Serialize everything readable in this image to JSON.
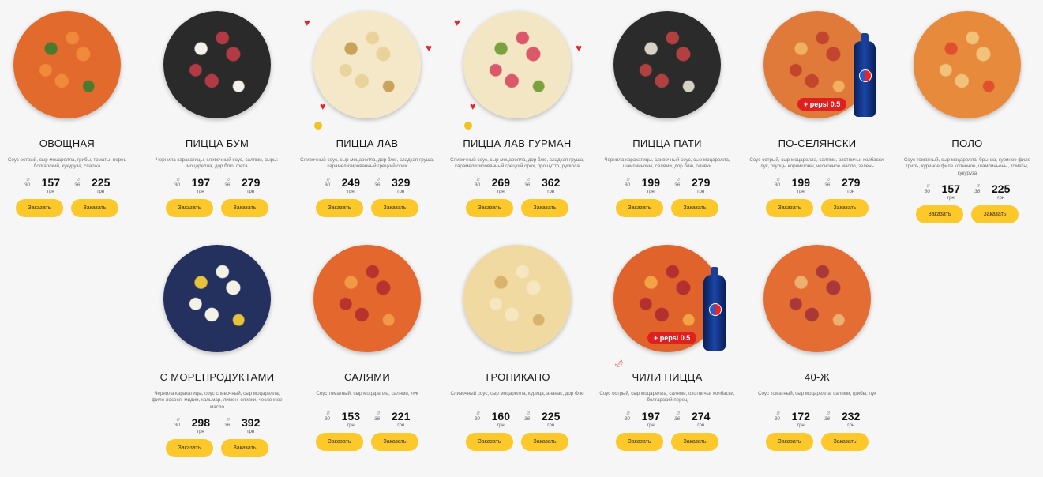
{
  "colors": {
    "button_bg": "#fdc829",
    "background": "#f6f6f6",
    "pepsi_badge": "#e02020"
  },
  "sizes": {
    "small": "30",
    "large": "36"
  },
  "currency": "грн",
  "order_label": "Заказать",
  "pepsi_badge": "+ pepsi 0.5",
  "pizzas": [
    {
      "name": "ОВОЩНАЯ",
      "desc": "Соус острый, сыр моцарелла, грибы, томаты, перец болгарский, кукуруза, спаржа",
      "price_small": "157",
      "price_large": "225",
      "palette": [
        "#e26a2c",
        "#f08a3a",
        "#4a7a2e"
      ]
    },
    {
      "name": "ПИЦЦА БУМ",
      "desc": "Чернила каракатицы, сливочный соус, салями, сыры: моцарелла, дор блю, фета",
      "price_small": "197",
      "price_large": "279",
      "palette": [
        "#2a2a2a",
        "#b23a45",
        "#f4f0ea"
      ]
    },
    {
      "name": "ПИЦЦА ЛАВ",
      "desc": "Сливочный соус, сыр моцарелла, дор блю, сладкая груша, карамелизированный грецкий орех",
      "price_small": "249",
      "price_large": "329",
      "palette": [
        "#f4e8c8",
        "#e9d39a",
        "#c9a25c"
      ]
    },
    {
      "name": "ПИЦЦА ЛАВ ГУРМАН",
      "desc": "Сливочный соус, сыр моцарелла, дор блю, сладкая груша, карамелизированный грецкий орех, прошутто, руккола",
      "price_small": "269",
      "price_large": "362",
      "palette": [
        "#f3e6c4",
        "#d9586a",
        "#7aa13e"
      ]
    },
    {
      "name": "ПИЦЦА ПАТИ",
      "desc": "Чернила каракатицы, сливочный соус, сыр моцарелла, шампиньоны, салями, дор блю, оливки",
      "price_small": "199",
      "price_large": "279",
      "palette": [
        "#2b2b2b",
        "#b34040",
        "#d8d1c6"
      ]
    },
    {
      "name": "ПО-СЕЛЯНСКИ",
      "desc": "Соус острый, сыр моцарелла, салями, охотничьи колбаски, лук, огурцы корнишоны, чесночное масло, зелень",
      "price_small": "199",
      "price_large": "279",
      "palette": [
        "#e07a3a",
        "#c4452e",
        "#f0b060"
      ]
    },
    {
      "name": "ПОЛО",
      "desc": "Соус томатный, сыр моцарелла, брынза, куриное филе гриль, куриное филе копченое, шампиньоны, томаты, кукуруза",
      "price_small": "157",
      "price_large": "225",
      "palette": [
        "#e88a3c",
        "#f3c27a",
        "#e0502e"
      ]
    },
    {
      "name": "С МОРЕПРОДУКТАМИ",
      "desc": "Чернила каракатицы, соус сливочный, сыр моцарелла, филе лосося, мидии, кальмар, лимон, оливки, чесночное масло",
      "price_small": "298",
      "price_large": "392",
      "palette": [
        "#24305e",
        "#f4f1e6",
        "#e8c23a"
      ]
    },
    {
      "name": "САЛЯМИ",
      "desc": "Соус томатный, сыр моцарелла, салями, лук",
      "price_small": "153",
      "price_large": "221",
      "palette": [
        "#e4682e",
        "#b8322e",
        "#f09a45"
      ]
    },
    {
      "name": "ТРОПИКАНО",
      "desc": "Сливочный соус, сыр моцарелла, курица, ананас, дор блю",
      "price_small": "160",
      "price_large": "225",
      "palette": [
        "#f1d9a2",
        "#f6e7c0",
        "#d9b36b"
      ]
    },
    {
      "name": "ЧИЛИ ПИЦЦА",
      "desc": "Соус острый, сыр моцарелла, салями, охотничьи колбаски, болгарский перец",
      "price_small": "197",
      "price_large": "274",
      "palette": [
        "#e0632c",
        "#b42f2f",
        "#f2a344"
      ]
    },
    {
      "name": "40-Ж",
      "desc": "Соус томатный, сыр моцарелла, салями, грибы, лук",
      "price_small": "172",
      "price_large": "232",
      "palette": [
        "#e46d33",
        "#a93838",
        "#ecb070"
      ]
    }
  ]
}
